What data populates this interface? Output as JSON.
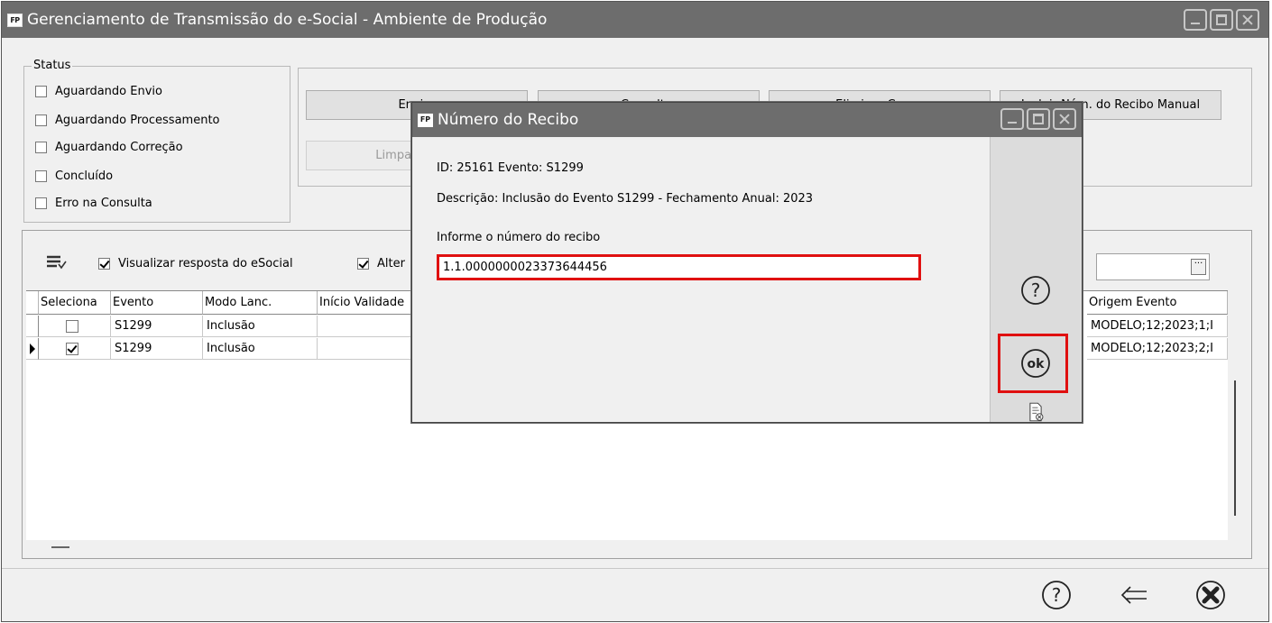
{
  "main_window": {
    "title": "Gerenciamento de Transmissão do e-Social - Ambiente de Produção",
    "app_icon_text": "FP"
  },
  "status": {
    "legend": "Status",
    "items": [
      {
        "label": "Aguardando Envio",
        "checked": false
      },
      {
        "label": "Aguardando Processamento",
        "checked": false
      },
      {
        "label": "Aguardando Correção",
        "checked": false
      },
      {
        "label": "Concluído",
        "checked": false
      },
      {
        "label": "Erro na Consulta",
        "checked": false
      }
    ]
  },
  "actions": {
    "enviar": "Enviar",
    "consultar": "Consultar",
    "eliminar": "Eliminar Consu",
    "incluir_recibo": "Incluir Núm. do Recibo Manual",
    "limpar": "Limpar (Produ"
  },
  "grid_options": {
    "visualizar_resposta": {
      "label": "Visualizar resposta do eSocial",
      "checked": true
    },
    "alterar": {
      "label": "Alter",
      "checked": true
    },
    "combo_value": ""
  },
  "grid": {
    "columns": [
      "Seleciona",
      "Evento",
      "Modo Lanc.",
      "Início Validade",
      "Origem Evento"
    ],
    "rows": [
      {
        "selected": false,
        "evento": "S1299",
        "modo": "Inclusão",
        "inicio": "",
        "origem": "MODELO;12;2023;1;I",
        "current": false
      },
      {
        "selected": true,
        "evento": "S1299",
        "modo": "Inclusão",
        "inicio": "",
        "origem": "MODELO;12;2023;2;I",
        "current": true
      }
    ]
  },
  "dialog": {
    "title": "Número do Recibo",
    "app_icon_text": "FP",
    "id_line": "ID: 25161 Evento: S1299",
    "descricao": "Descrição: Inclusão do Evento S1299 - Fechamento Anual: 2023",
    "input_label": "Informe o número do recibo",
    "input_value": "1.1.0000000023373644456"
  },
  "icons": {
    "help": "question-circle",
    "ok": "ok-circle",
    "cancel_doc": "document-cancel",
    "back": "arrow-left",
    "close": "x-circle",
    "accent_red": "#e01010",
    "titlebar_gray": "#6d6d6d"
  }
}
